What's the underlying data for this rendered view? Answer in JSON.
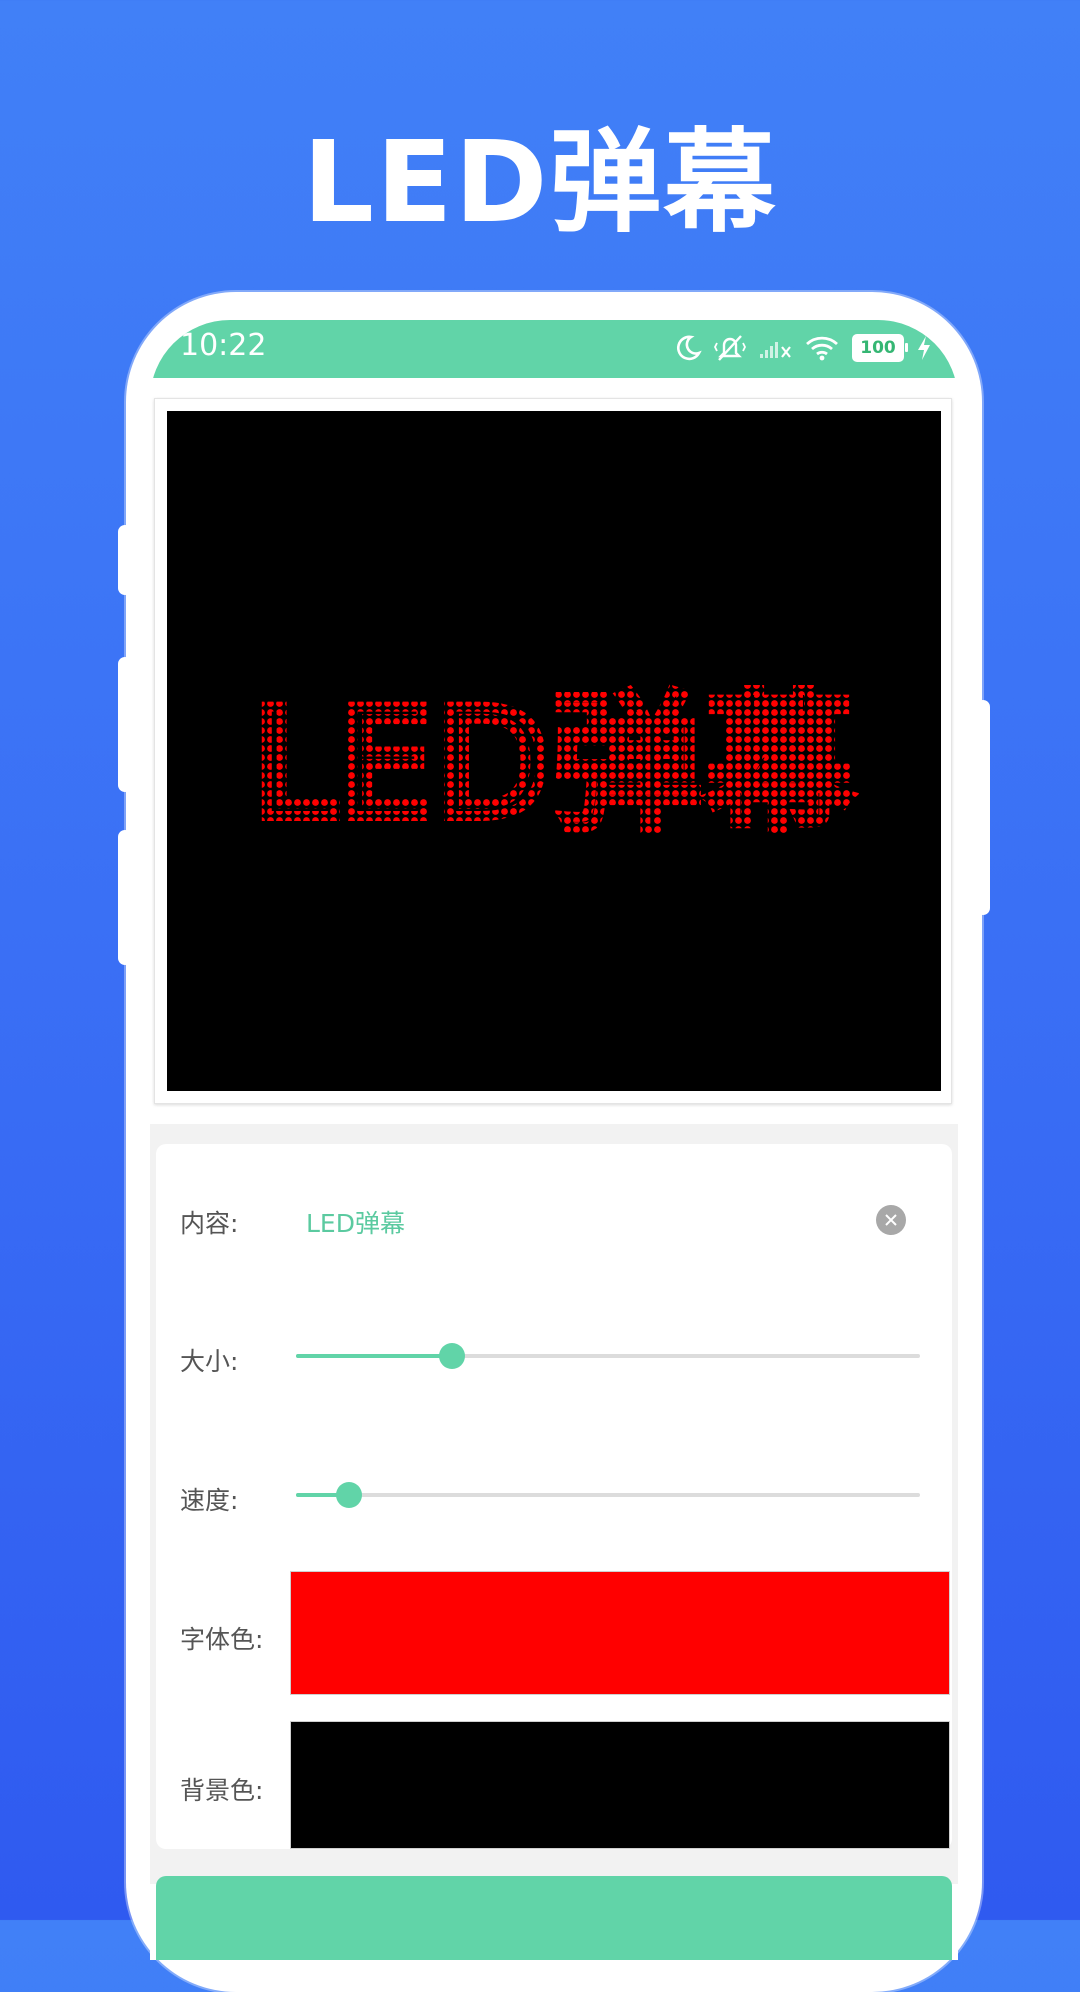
{
  "promo": {
    "title": "LED弹幕"
  },
  "status_bar": {
    "time": "10:22",
    "battery": "100",
    "icons": [
      "moon-icon",
      "mute-vibrate-icon",
      "signal-off-icon",
      "wifi-icon",
      "battery-icon",
      "charging-icon"
    ]
  },
  "led_preview": {
    "text": "LED弹幕",
    "text_color": "#ff0000",
    "background_color": "#000000"
  },
  "controls": {
    "content": {
      "label": "内容:",
      "value": "LED弹幕"
    },
    "size": {
      "label": "大小:",
      "value": 0.25
    },
    "speed": {
      "label": "速度:",
      "value": 0.085
    },
    "font_color": {
      "label": "字体色:",
      "color": "#ff0000"
    },
    "bg_color": {
      "label": "背景色:",
      "color": "#000000"
    }
  },
  "colors": {
    "accent": "#61d4a8",
    "background_top": "#4180f7",
    "background_bottom": "#2f5af0"
  }
}
